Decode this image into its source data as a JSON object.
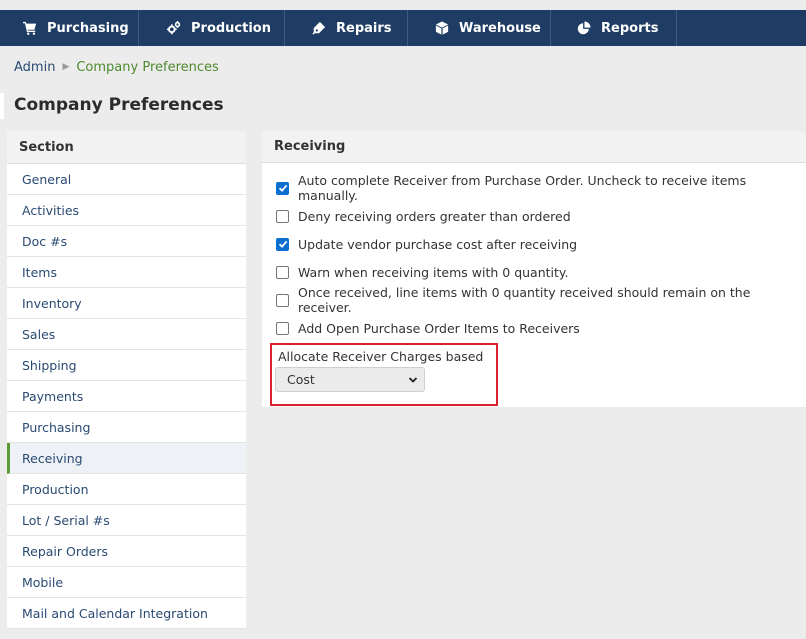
{
  "nav": {
    "items": [
      {
        "label": "Purchasing",
        "icon": "cart-icon"
      },
      {
        "label": "Production",
        "icon": "gears-icon"
      },
      {
        "label": "Repairs",
        "icon": "wrench-icon"
      },
      {
        "label": "Warehouse",
        "icon": "box-icon"
      },
      {
        "label": "Reports",
        "icon": "pie-chart-icon"
      }
    ]
  },
  "breadcrumb": {
    "root": "Admin",
    "current": "Company Preferences"
  },
  "page": {
    "title": "Company Preferences"
  },
  "sidebar": {
    "header": "Section",
    "items": [
      {
        "label": "General",
        "active": false
      },
      {
        "label": "Activities",
        "active": false
      },
      {
        "label": "Doc #s",
        "active": false
      },
      {
        "label": "Items",
        "active": false
      },
      {
        "label": "Inventory",
        "active": false
      },
      {
        "label": "Sales",
        "active": false
      },
      {
        "label": "Shipping",
        "active": false
      },
      {
        "label": "Payments",
        "active": false
      },
      {
        "label": "Purchasing",
        "active": false
      },
      {
        "label": "Receiving",
        "active": true
      },
      {
        "label": "Production",
        "active": false
      },
      {
        "label": "Lot / Serial #s",
        "active": false
      },
      {
        "label": "Repair Orders",
        "active": false
      },
      {
        "label": "Mobile",
        "active": false
      },
      {
        "label": "Mail and Calendar Integration",
        "active": false
      }
    ]
  },
  "receiving": {
    "header": "Receiving",
    "options": [
      {
        "label": "Auto complete Receiver from Purchase Order. Uncheck to receive items manually.",
        "checked": true
      },
      {
        "label": "Deny receiving orders greater than ordered",
        "checked": false
      },
      {
        "label": "Update vendor purchase cost after receiving",
        "checked": true
      },
      {
        "label": "Warn when receiving items with 0 quantity.",
        "checked": false
      },
      {
        "label": "Once received, line items with 0 quantity received should remain on the receiver.",
        "checked": false
      },
      {
        "label": "Add Open Purchase Order Items to Receivers",
        "checked": false
      }
    ],
    "allocate_label": "Allocate Receiver Charges based on:",
    "allocate_value": "Cost"
  },
  "colors": {
    "nav_bg": "#1f3d64",
    "link": "#2a4a72",
    "breadcrumb_current": "#4e8a2e",
    "active_marker": "#5b9a34",
    "checkbox_checked": "#0a6fd1",
    "highlight_box": "#d9222b"
  }
}
